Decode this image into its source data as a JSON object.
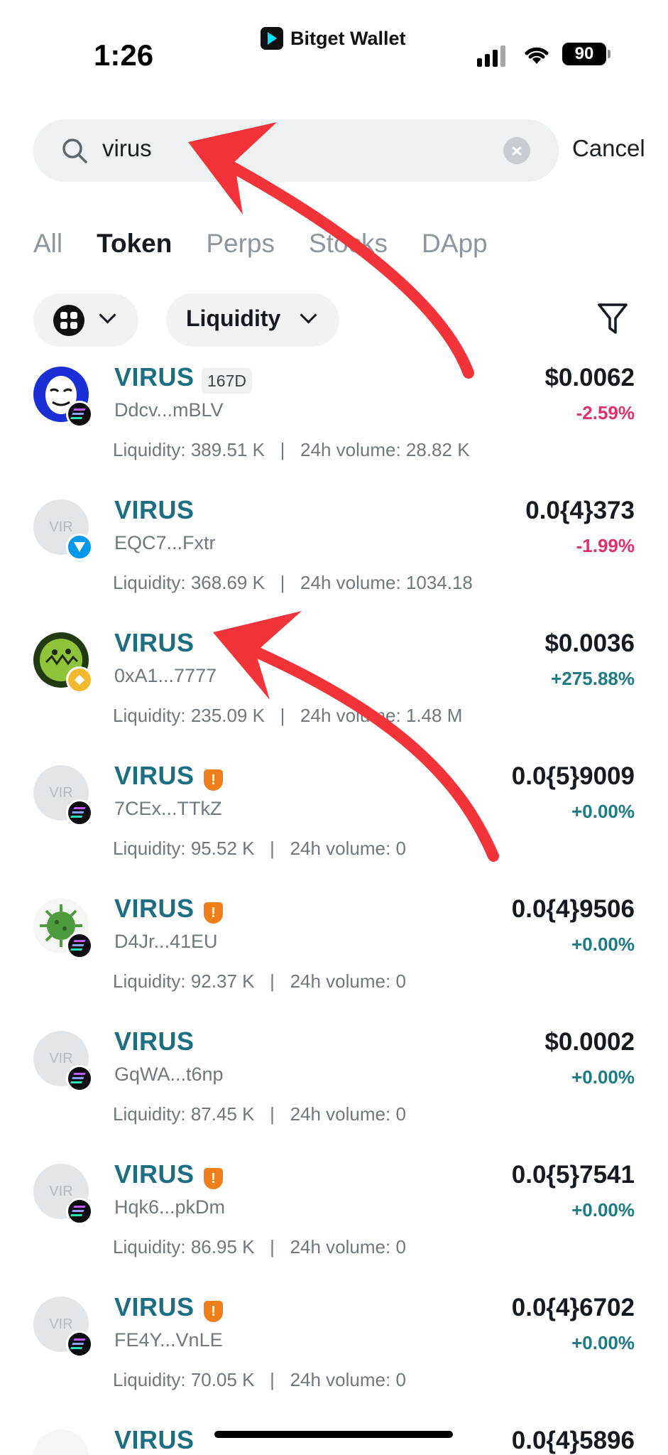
{
  "status_bar": {
    "time": "1:26",
    "app_name": "Bitget Wallet",
    "battery": "90"
  },
  "search": {
    "value": "virus",
    "cancel_label": "Cancel"
  },
  "tabs": [
    {
      "label": "All"
    },
    {
      "label": "Token",
      "active": true
    },
    {
      "label": "Perps"
    },
    {
      "label": "Stocks"
    },
    {
      "label": "DApp"
    }
  ],
  "filters": {
    "chain_icon": "all-chains-icon",
    "sort_label": "Liquidity"
  },
  "colors": {
    "token_name": "#1c6e82",
    "negative": "#e0306f",
    "positive": "#1c7b85",
    "warning": "#f07e1b",
    "annotation_arrow": "#f2333a"
  },
  "tokens": [
    {
      "name": "VIRUS",
      "age": "167D",
      "address": "Ddcv...mBLV",
      "chain": "solana",
      "price": "$0.0062",
      "change": "-2.59%",
      "liquidity": "Liquidity: 389.51 K",
      "volume": "24h volume: 28.82 K"
    },
    {
      "name": "VIRUS",
      "avatar_text": "VIR",
      "address": "EQC7...Fxtr",
      "chain": "ton",
      "price": "0.0{4}373",
      "change": "-1.99%",
      "liquidity": "Liquidity: 368.69 K",
      "volume": "24h volume: 1034.18"
    },
    {
      "name": "VIRUS",
      "address": "0xA1...7777",
      "chain": "bnb",
      "price": "$0.0036",
      "change": "+275.88%",
      "liquidity": "Liquidity: 235.09 K",
      "volume": "24h volume: 1.48 M"
    },
    {
      "name": "VIRUS",
      "avatar_text": "VIR",
      "warning": "!",
      "address": "7CEx...TTkZ",
      "chain": "solana",
      "price": "0.0{5}9009",
      "change": "+0.00%",
      "liquidity": "Liquidity: 95.52 K",
      "volume": "24h volume: 0"
    },
    {
      "name": "VIRUS",
      "warning": "!",
      "address": "D4Jr...41EU",
      "chain": "solana",
      "price": "0.0{4}9506",
      "change": "+0.00%",
      "liquidity": "Liquidity: 92.37 K",
      "volume": "24h volume: 0"
    },
    {
      "name": "VIRUS",
      "avatar_text": "VIR",
      "address": "GqWA...t6np",
      "chain": "solana",
      "price": "$0.0002",
      "change": "+0.00%",
      "liquidity": "Liquidity: 87.45 K",
      "volume": "24h volume: 0"
    },
    {
      "name": "VIRUS",
      "avatar_text": "VIR",
      "warning": "!",
      "address": "Hqk6...pkDm",
      "chain": "solana",
      "price": "0.0{5}7541",
      "change": "+0.00%",
      "liquidity": "Liquidity: 86.95 K",
      "volume": "24h volume: 0"
    },
    {
      "name": "VIRUS",
      "avatar_text": "VIR",
      "warning": "!",
      "address": "FE4Y...VnLE",
      "chain": "solana",
      "price": "0.0{4}6702",
      "change": "+0.00%",
      "liquidity": "Liquidity: 70.05 K",
      "volume": "24h volume: 0"
    },
    {
      "name": "VIRUS",
      "price": "0.0{4}5896"
    }
  ]
}
